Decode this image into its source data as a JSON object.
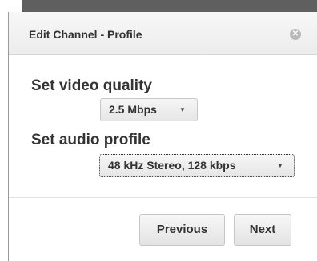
{
  "dialog": {
    "title": "Edit Channel - Profile",
    "close_icon": "close-icon"
  },
  "video": {
    "label": "Set video quality",
    "selected": "2.5 Mbps"
  },
  "audio": {
    "label": "Set audio profile",
    "selected": "48 kHz Stereo, 128 kbps"
  },
  "buttons": {
    "previous": "Previous",
    "next": "Next"
  }
}
